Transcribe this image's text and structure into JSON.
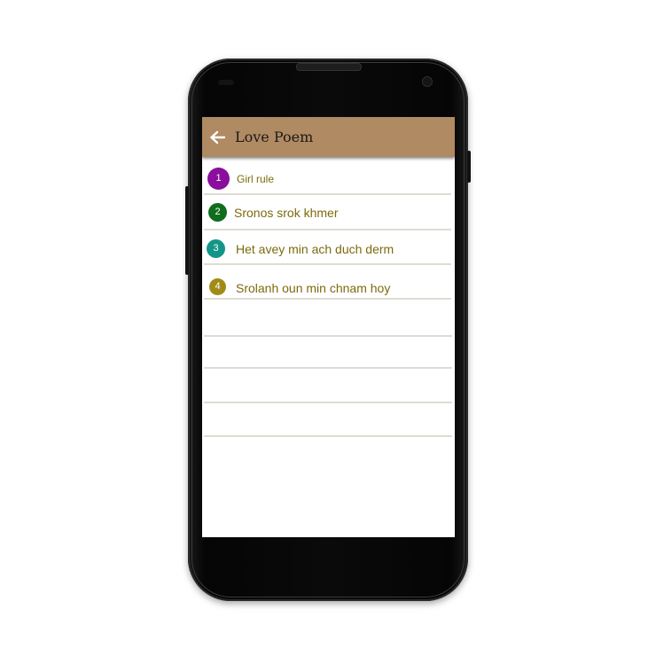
{
  "app": {
    "title": "Love Poem",
    "back_icon": "arrow-left-icon",
    "accent_color": "#b08a62"
  },
  "poems": [
    {
      "number": "1",
      "title": "Girl rule",
      "badge_color": "#8a0f9c"
    },
    {
      "number": "2",
      "title": "Sronos srok khmer",
      "badge_color": "#0f6e1e"
    },
    {
      "number": "3",
      "title": "Het avey min ach duch derm",
      "badge_color": "#139688"
    },
    {
      "number": "4",
      "title": "Srolanh oun min chnam hoy",
      "badge_color": "#a08b17"
    }
  ]
}
